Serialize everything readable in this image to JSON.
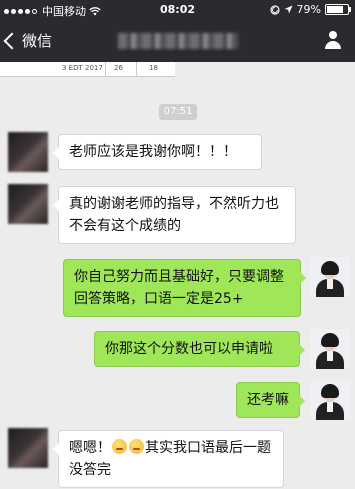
{
  "status_bar": {
    "carrier": "中国移动",
    "time": "08:02",
    "battery_percent": "79%",
    "battery_level": 0.79
  },
  "nav": {
    "back_label": "微信"
  },
  "table_snippet": {
    "cells": [
      "3 EDT 2017",
      "26",
      "18"
    ]
  },
  "timestamp": "07:51",
  "messages": [
    {
      "side": "in",
      "text": "老师应该是我谢你啊！！！"
    },
    {
      "side": "in",
      "text": "真的谢谢老师的指导，不然听力也不会有这个成绩的"
    },
    {
      "side": "out",
      "text": "你自己努力而且基础好，只要调整回答策略，口语一定是25+"
    },
    {
      "side": "out",
      "text": "你那这个分数也可以申请啦"
    },
    {
      "side": "out",
      "text": "还考嘛"
    },
    {
      "side": "in",
      "text_before": "嗯嗯！",
      "text_after": "其实我口语最后一题没答完"
    }
  ],
  "icons": [
    "signal-dots-icon",
    "wifi-icon",
    "lock-icon",
    "location-arrow-icon",
    "battery-icon",
    "back-chevron-icon",
    "contact-person-icon",
    "emoji-icon"
  ]
}
